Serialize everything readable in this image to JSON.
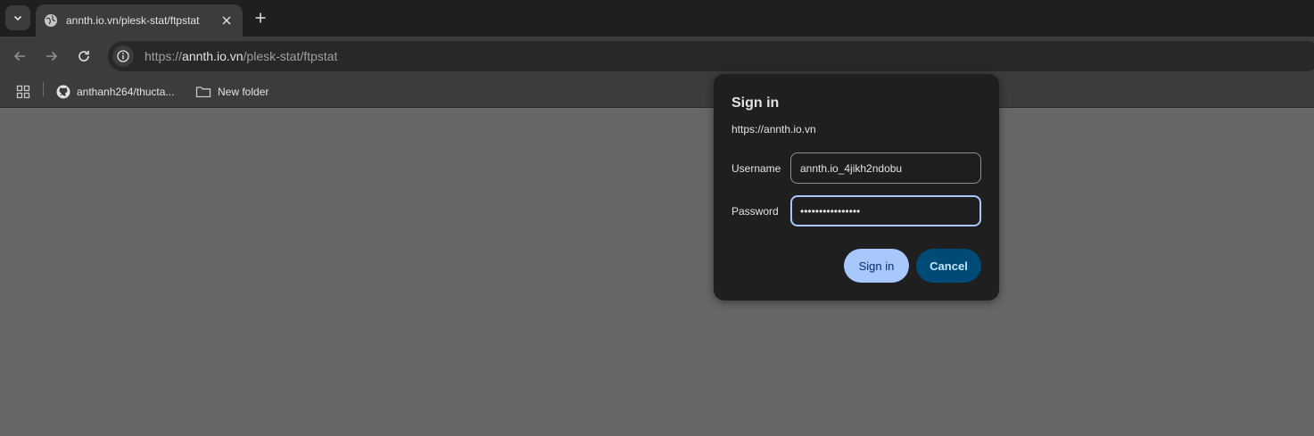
{
  "tab": {
    "title": "annth.io.vn/plesk-stat/ftpstat"
  },
  "address_bar": {
    "scheme": "https://",
    "host": "annth.io.vn",
    "path": "/plesk-stat/ftpstat"
  },
  "bookmarks": [
    {
      "label": "anthanh264/thucta...",
      "icon": "github-icon"
    },
    {
      "label": "New folder",
      "icon": "folder-icon"
    }
  ],
  "dialog": {
    "title": "Sign in",
    "origin": "https://annth.io.vn",
    "username_label": "Username",
    "username_value": "annth.io_4jikh2ndobu",
    "password_label": "Password",
    "password_value": "••••••••••••••••",
    "signin_label": "Sign in",
    "cancel_label": "Cancel"
  }
}
